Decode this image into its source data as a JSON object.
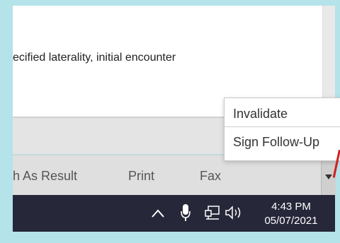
{
  "diagnosis_text": "ecified laterality, initial encounter",
  "button_bar": {
    "items": [
      {
        "label": "h As Result"
      },
      {
        "label": "Print"
      },
      {
        "label": "Fax"
      }
    ]
  },
  "popup_menu": {
    "items": [
      {
        "label": "Invalidate"
      },
      {
        "label": "Sign Follow-Up"
      }
    ]
  },
  "taskbar": {
    "icons": [
      "chevron-up-icon",
      "microphone-icon",
      "network-icon",
      "volume-icon"
    ],
    "time": "4:43 PM",
    "date": "05/07/2021"
  },
  "colors": {
    "outer_background": "#b4e3ea",
    "taskbar": "#262739",
    "button_bar": "#dfdfdf"
  }
}
